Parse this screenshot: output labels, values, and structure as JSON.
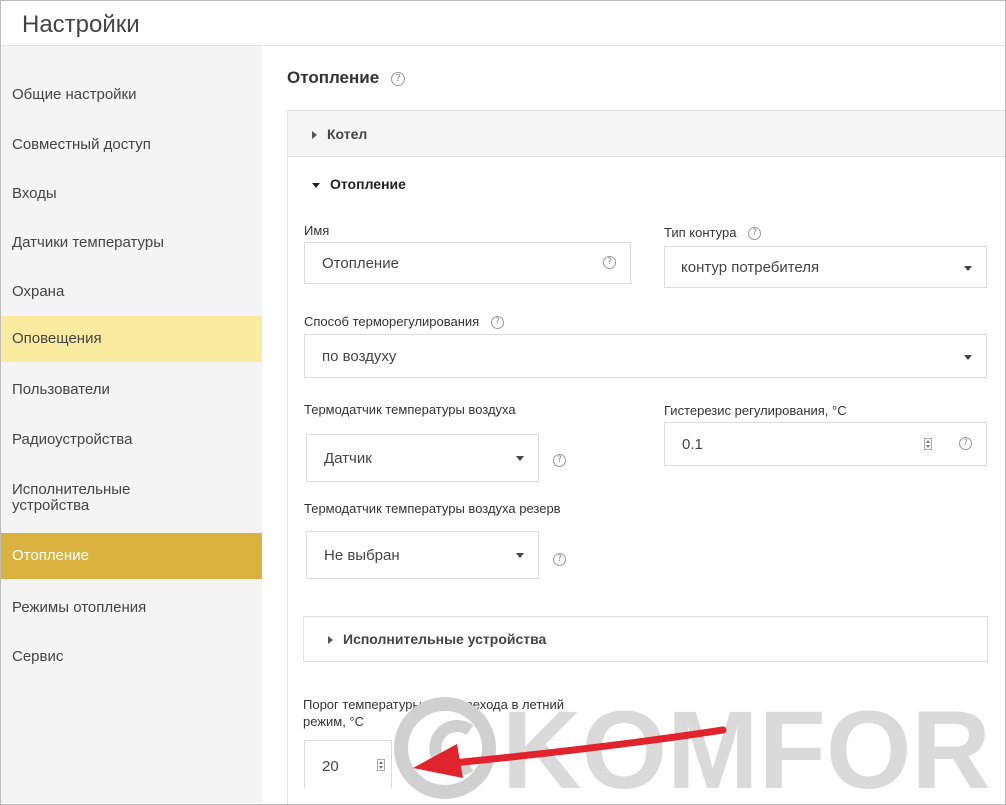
{
  "header": {
    "title": "Настройки"
  },
  "sidebar": {
    "items": [
      {
        "label": "Общие настройки"
      },
      {
        "label": "Совместный доступ"
      },
      {
        "label": "Входы"
      },
      {
        "label": "Датчики температуры"
      },
      {
        "label": "Охрана"
      },
      {
        "label": "Оповещения"
      },
      {
        "label": "Пользователи"
      },
      {
        "label": "Радиоустройства"
      },
      {
        "label": "Исполнительные устройства"
      },
      {
        "label": "Отопление"
      },
      {
        "label": "Режимы отопления"
      },
      {
        "label": "Сервис"
      }
    ]
  },
  "main": {
    "title": "Отопление",
    "help_icon": "?",
    "boiler_section": {
      "label": "Котел"
    },
    "heating_section": {
      "label": "Отопление",
      "name": {
        "label": "Имя",
        "value": "Отопление"
      },
      "circuit_type": {
        "label": "Тип контура",
        "value": "контур потребителя"
      },
      "regulation_method": {
        "label": "Способ терморегулирования",
        "value": "по воздуху"
      },
      "air_sensor": {
        "label": "Термодатчик температуры воздуха",
        "value": "Датчик"
      },
      "hysteresis": {
        "label": "Гистерезис регулирования, °C",
        "value": "0.1"
      },
      "air_sensor_reserve": {
        "label": "Термодатчик температуры воздуха резерв",
        "value": "Не выбран"
      },
      "actuators_section": {
        "label": "Исполнительные устройства"
      },
      "summer_threshold": {
        "label_line1": "Порог температуры для перехода в летний",
        "label_line2": "режим, °C",
        "value": "20"
      }
    }
  },
  "watermark": {
    "text": "KOMFORT"
  },
  "colors": {
    "sidebar_highlight": "#f9eca0",
    "sidebar_active": "#d9b240",
    "arrow": "#e0232d"
  }
}
